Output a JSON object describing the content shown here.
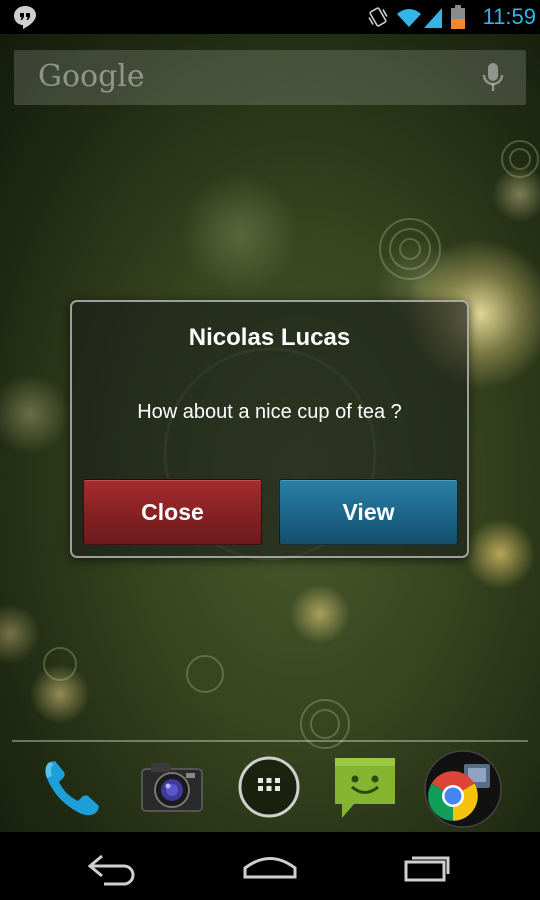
{
  "status_bar": {
    "time": "11:59",
    "icons": [
      "hangouts-icon",
      "vibrate-icon",
      "wifi-icon",
      "signal-icon",
      "battery-icon"
    ],
    "accent_color": "#33b5e5"
  },
  "search": {
    "logo_text": "Google",
    "icon": "mic-icon"
  },
  "dialog": {
    "title": "Nicolas Lucas",
    "message": "How about a nice cup of tea ?",
    "close_label": "Close",
    "view_label": "View",
    "close_color": "#8b2326",
    "view_color": "#1f6a8e"
  },
  "dock": {
    "items": [
      "phone-icon",
      "camera-icon",
      "all-apps-icon",
      "messaging-icon",
      "chrome-icon"
    ]
  },
  "nav_bar": {
    "buttons": [
      "back-icon",
      "home-icon",
      "recents-icon"
    ]
  }
}
